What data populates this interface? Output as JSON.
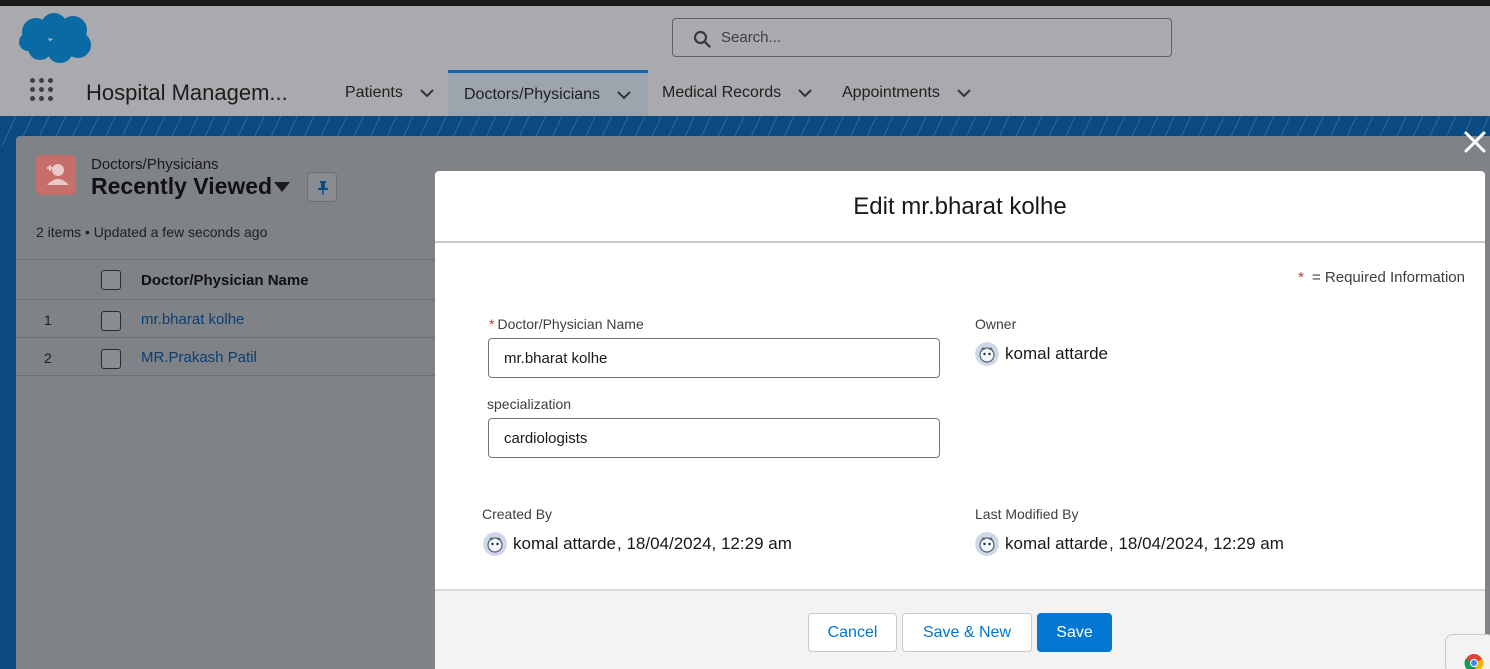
{
  "header": {
    "search_placeholder": "Search..."
  },
  "nav": {
    "app_name": "Hospital Managem...",
    "tabs": [
      {
        "label": "Patients"
      },
      {
        "label": "Doctors/Physicians"
      },
      {
        "label": "Medical Records"
      },
      {
        "label": "Appointments"
      }
    ]
  },
  "list_view": {
    "object_label": "Doctors/Physicians",
    "title": "Recently Viewed",
    "info": "2 items • Updated a few seconds ago",
    "column_header": "Doctor/Physician Name",
    "rows": [
      {
        "num": "1",
        "name": "mr.bharat kolhe"
      },
      {
        "num": "2",
        "name": "MR.Prakash Patil"
      }
    ]
  },
  "modal": {
    "title": "Edit mr.bharat kolhe",
    "required_star": "*",
    "required_info": "= Required Information",
    "fields": {
      "name_label": "Doctor/Physician Name",
      "name_value": "mr.bharat kolhe",
      "specialization_label": "specialization",
      "specialization_value": "cardiologists",
      "owner_label": "Owner",
      "owner_value": "komal attarde",
      "created_by_label": "Created By",
      "created_by_user": "komal attarde",
      "created_by_date": ", 18/04/2024, 12:29 am",
      "modified_by_label": "Last Modified By",
      "modified_by_user": "komal attarde",
      "modified_by_date": ", 18/04/2024, 12:29 am"
    },
    "buttons": {
      "cancel": "Cancel",
      "save_new": "Save & New",
      "save": "Save"
    }
  },
  "colors": {
    "brand": "#0176d3",
    "required": "#c23934",
    "link": "#0b3e73"
  }
}
